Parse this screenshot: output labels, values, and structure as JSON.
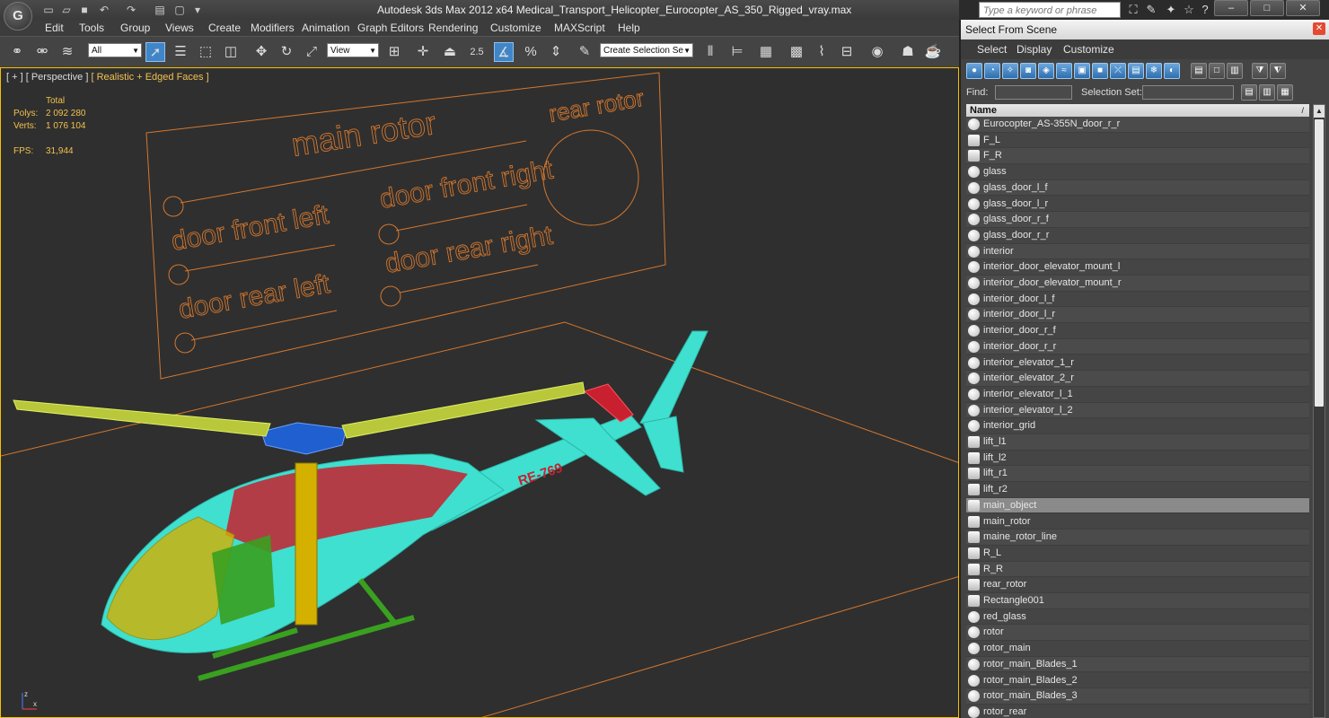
{
  "app": {
    "logo": "G",
    "title": "Autodesk 3ds Max  2012 x64     Medical_Transport_Helicopter_Eurocopter_AS_350_Rigged_vray.max",
    "search_placeholder": "Type a keyword or phrase",
    "win_minimize": "–",
    "win_maximize": "□",
    "win_close": "✕"
  },
  "menu": [
    "Edit",
    "Tools",
    "Group",
    "Views",
    "Create",
    "Modifiers",
    "Animation",
    "Graph Editors",
    "Rendering",
    "Customize",
    "MAXScript",
    "Help"
  ],
  "toolbar": {
    "filter": "All",
    "ref_coord": "View",
    "snap_label": "2.5",
    "selection_set": "Create Selection Se"
  },
  "viewport": {
    "label_bracket": "[ + ]",
    "label_view": "[ Perspective ]",
    "label_shading": "[ Realistic + Edged Faces ]",
    "stats": {
      "total_label": "Total",
      "polys_label": "Polys:",
      "polys_value": "2 092 280",
      "verts_label": "Verts:",
      "verts_value": "1 076 104",
      "fps_label": "FPS:",
      "fps_value": "31,944"
    },
    "board": {
      "main_rotor": "main rotor",
      "rear_rotor": "rear rotor",
      "door_front_left": "door front left",
      "door_front_right": "door front right",
      "door_rear_left": "door rear left",
      "door_rear_right": "door rear right"
    },
    "registration": "RE-769",
    "axis_x": "x",
    "axis_z": "z"
  },
  "panel": {
    "title": "Select From Scene",
    "menu": [
      "Select",
      "Display",
      "Customize"
    ],
    "find_label": "Find:",
    "selection_set_label": "Selection Set:",
    "column_name": "Name",
    "sort_arrow": "/",
    "scroll_up": "▲",
    "close": "✕",
    "selected_item": "main_object",
    "objects": [
      {
        "name": "Eurocopter_AS-355N_door_r_r",
        "type": "mesh"
      },
      {
        "name": "F_L",
        "type": "group"
      },
      {
        "name": "F_R",
        "type": "group"
      },
      {
        "name": "glass",
        "type": "mesh"
      },
      {
        "name": "glass_door_l_f",
        "type": "mesh"
      },
      {
        "name": "glass_door_l_r",
        "type": "mesh"
      },
      {
        "name": "glass_door_r_f",
        "type": "mesh"
      },
      {
        "name": "glass_door_r_r",
        "type": "mesh"
      },
      {
        "name": "interior",
        "type": "mesh"
      },
      {
        "name": "interior_door_elevator_mount_l",
        "type": "mesh"
      },
      {
        "name": "interior_door_elevator_mount_r",
        "type": "mesh"
      },
      {
        "name": "interior_door_l_f",
        "type": "mesh"
      },
      {
        "name": "interior_door_l_r",
        "type": "mesh"
      },
      {
        "name": "interior_door_r_f",
        "type": "mesh"
      },
      {
        "name": "interior_door_r_r",
        "type": "mesh"
      },
      {
        "name": "interior_elevator_1_r",
        "type": "mesh"
      },
      {
        "name": "interior_elevator_2_r",
        "type": "mesh"
      },
      {
        "name": "interior_elevator_l_1",
        "type": "mesh"
      },
      {
        "name": "interior_elevator_l_2",
        "type": "mesh"
      },
      {
        "name": "interior_grid",
        "type": "mesh"
      },
      {
        "name": "lift_l1",
        "type": "group"
      },
      {
        "name": "lift_l2",
        "type": "group"
      },
      {
        "name": "lift_r1",
        "type": "group"
      },
      {
        "name": "lift_r2",
        "type": "group"
      },
      {
        "name": "main_object",
        "type": "group"
      },
      {
        "name": "main_rotor",
        "type": "group"
      },
      {
        "name": "maine_rotor_line",
        "type": "group"
      },
      {
        "name": "R_L",
        "type": "group"
      },
      {
        "name": "R_R",
        "type": "group"
      },
      {
        "name": "rear_rotor",
        "type": "group"
      },
      {
        "name": "Rectangle001",
        "type": "group"
      },
      {
        "name": "red_glass",
        "type": "mesh"
      },
      {
        "name": "rotor",
        "type": "mesh"
      },
      {
        "name": "rotor_main",
        "type": "mesh"
      },
      {
        "name": "rotor_main_Blades_1",
        "type": "mesh"
      },
      {
        "name": "rotor_main_Blades_2",
        "type": "mesh"
      },
      {
        "name": "rotor_main_Blades_3",
        "type": "mesh"
      },
      {
        "name": "rotor_rear",
        "type": "mesh"
      }
    ]
  },
  "colors": {
    "accent": "#f2c14e",
    "board_lines": "#d4772e",
    "helicopter_wire": "#3fe0d0",
    "helicopter_red": "#c8202e",
    "helicopter_yellow": "#d4b000",
    "helicopter_green": "#3aa020",
    "rotor_hub": "#1f5fcf",
    "blades": "#b8c83a"
  }
}
